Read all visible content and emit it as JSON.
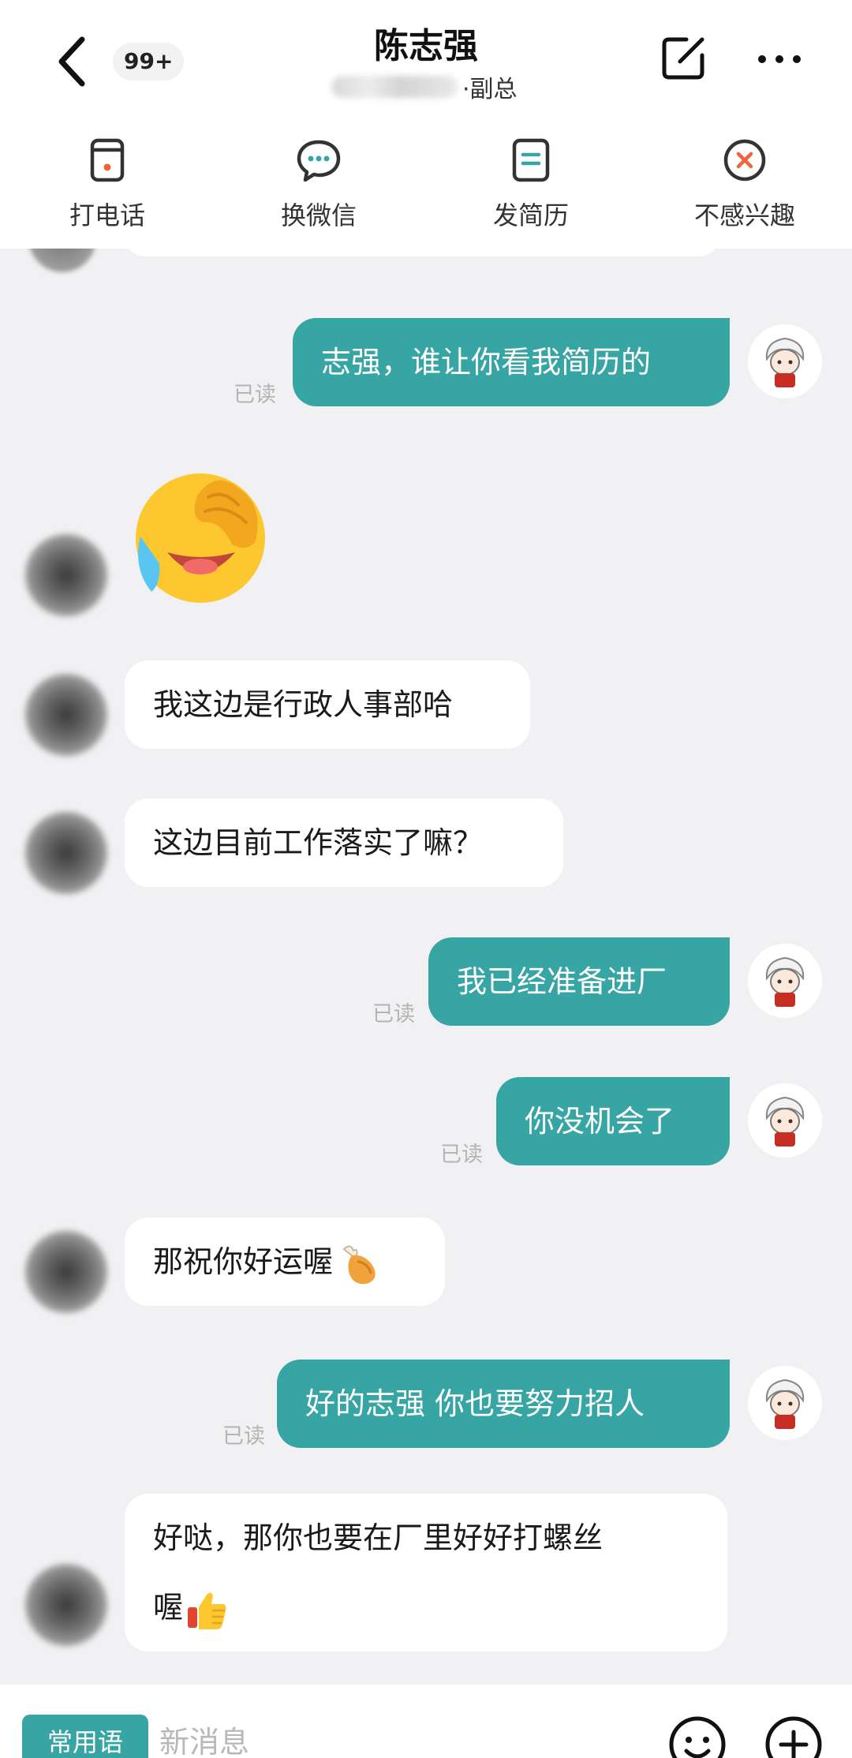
{
  "header": {
    "badge": "99+",
    "name": "陈志强",
    "title": "·副总"
  },
  "actions": [
    {
      "label": "打电话",
      "icon": "phone-card-icon"
    },
    {
      "label": "换微信",
      "icon": "wechat-icon"
    },
    {
      "label": "发简历",
      "icon": "resume-icon"
    },
    {
      "label": "不感兴趣",
      "icon": "not-interested-icon"
    }
  ],
  "messages": [
    {
      "from": "me",
      "text": "志强，谁让你看我简历的",
      "read": "已读"
    },
    {
      "from": "them",
      "type": "emoji",
      "emoji": "facepalm-laughing-emoji"
    },
    {
      "from": "them",
      "text": "我这边是行政人事部哈"
    },
    {
      "from": "them",
      "text": "这边目前工作落实了嘛？"
    },
    {
      "from": "me",
      "text": "我已经准备进厂",
      "read": "已读"
    },
    {
      "from": "me",
      "text": "你没机会了",
      "read": "已读"
    },
    {
      "from": "them",
      "text": "那祝你好运喔",
      "emoji": "chicken-leg-emoji"
    },
    {
      "from": "me",
      "text": "好的志强 你也要努力招人",
      "read": "已读"
    },
    {
      "from": "them",
      "text": "好哒，那你也要在厂里好好打螺丝",
      "text2": "喔",
      "emoji": "thumbs-up-emoji"
    }
  ],
  "bottom": {
    "phrases_label": "常用语",
    "input_placeholder": "新消息"
  },
  "colors": {
    "accent": "#37a5a4",
    "background": "#f1f1f3"
  }
}
